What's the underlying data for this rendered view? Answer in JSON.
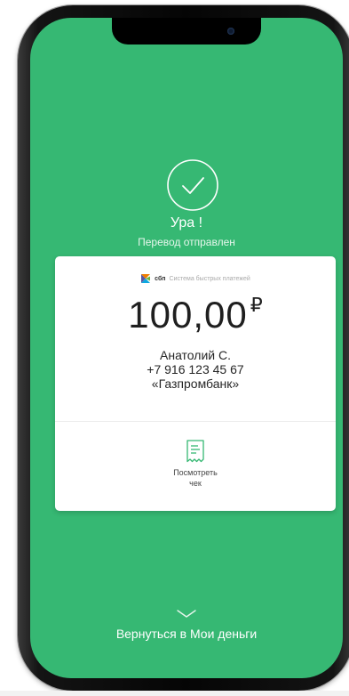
{
  "status": {
    "title": "Ура !",
    "subtitle": "Перевод отправлен"
  },
  "payment_system": {
    "brand": "сбп",
    "name": "Система быстрых платежей"
  },
  "transfer": {
    "amount": "100,00",
    "currency": "₽",
    "recipient_name": "Анатолий С.",
    "recipient_phone": "+7 916 123 45 67",
    "bank": "«Газпромбанк»"
  },
  "receipt": {
    "label_line1": "Посмотреть",
    "label_line2": "чек"
  },
  "footer": {
    "back_label": "Вернуться в Мои деньги"
  },
  "colors": {
    "background_green": "#36b873",
    "card": "#ffffff",
    "receipt_accent": "#36b873"
  },
  "icons": {
    "success": "check-circle-icon",
    "receipt": "receipt-icon",
    "chevron": "chevron-down-icon",
    "sbp": "sbp-logo-icon"
  }
}
